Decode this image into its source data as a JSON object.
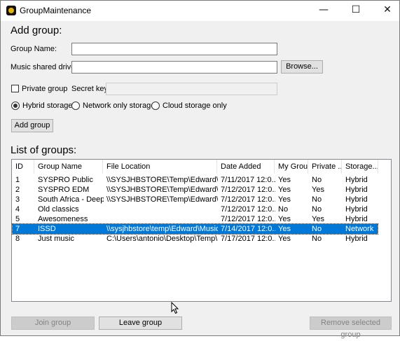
{
  "window": {
    "title": "GroupMaintenance",
    "minimize_glyph": "—",
    "maximize_glyph": "☐",
    "close_glyph": "✕"
  },
  "add_group": {
    "heading": "Add group:",
    "group_name_label": "Group Name:",
    "group_name_value": "",
    "music_drive_label": "Music shared drive:",
    "music_drive_value": "",
    "browse_label": "Browse...",
    "private_group_label": "Private group",
    "private_group_checked": false,
    "secret_key_label": "Secret key",
    "secret_key_value": "",
    "storage_options": [
      {
        "label": "Hybrid storage",
        "checked": true
      },
      {
        "label": "Network only storage",
        "checked": false
      },
      {
        "label": "Cloud storage only",
        "checked": false
      }
    ],
    "add_group_label": "Add group"
  },
  "list_of_groups": {
    "heading": "List of groups:",
    "columns": [
      "ID",
      "Group Name",
      "File Location",
      "Date Added",
      "My Group",
      "Private ...",
      "Storage..."
    ],
    "rows": [
      [
        "1",
        "SYSPRO Public",
        "\\\\SYSJHBSTORE\\Temp\\Edward\\M...",
        "7/11/2017 12:0...",
        "Yes",
        "No",
        "Hybrid"
      ],
      [
        "2",
        "SYSPRO EDM",
        "\\\\SYSJHBSTORE\\Temp\\Edward\\M...",
        "7/12/2017 12:0...",
        "Yes",
        "Yes",
        "Hybrid"
      ],
      [
        "3",
        "South Africa - Deep ...",
        "\\\\SYSJHBSTORE\\Temp\\Edward\\D...",
        "7/12/2017 12:0...",
        "Yes",
        "No",
        "Hybrid"
      ],
      [
        "4",
        "Old classics",
        "",
        "7/12/2017 12:0...",
        "No",
        "No",
        "Hybrid"
      ],
      [
        "5",
        "Awesomeness",
        "",
        "7/12/2017 12:0...",
        "Yes",
        "Yes",
        "Hybrid"
      ],
      [
        "7",
        "ISSD",
        "\\\\sysjhbstore\\temp\\Edward\\Music",
        "7/14/2017 12:0...",
        "Yes",
        "No",
        "Network"
      ],
      [
        "8",
        "Just music",
        "C:\\Users\\antonio\\Desktop\\Temp\\M...",
        "7/17/2017 12:0...",
        "Yes",
        "No",
        "Hybrid"
      ]
    ],
    "selected_row_index": 5
  },
  "actions": {
    "join_group_label": "Join group",
    "leave_group_label": "Leave group",
    "remove_selected_label": "Remove selected group"
  },
  "colors": {
    "selection": "#0078d7",
    "window_bg": "#f0f0f0"
  }
}
